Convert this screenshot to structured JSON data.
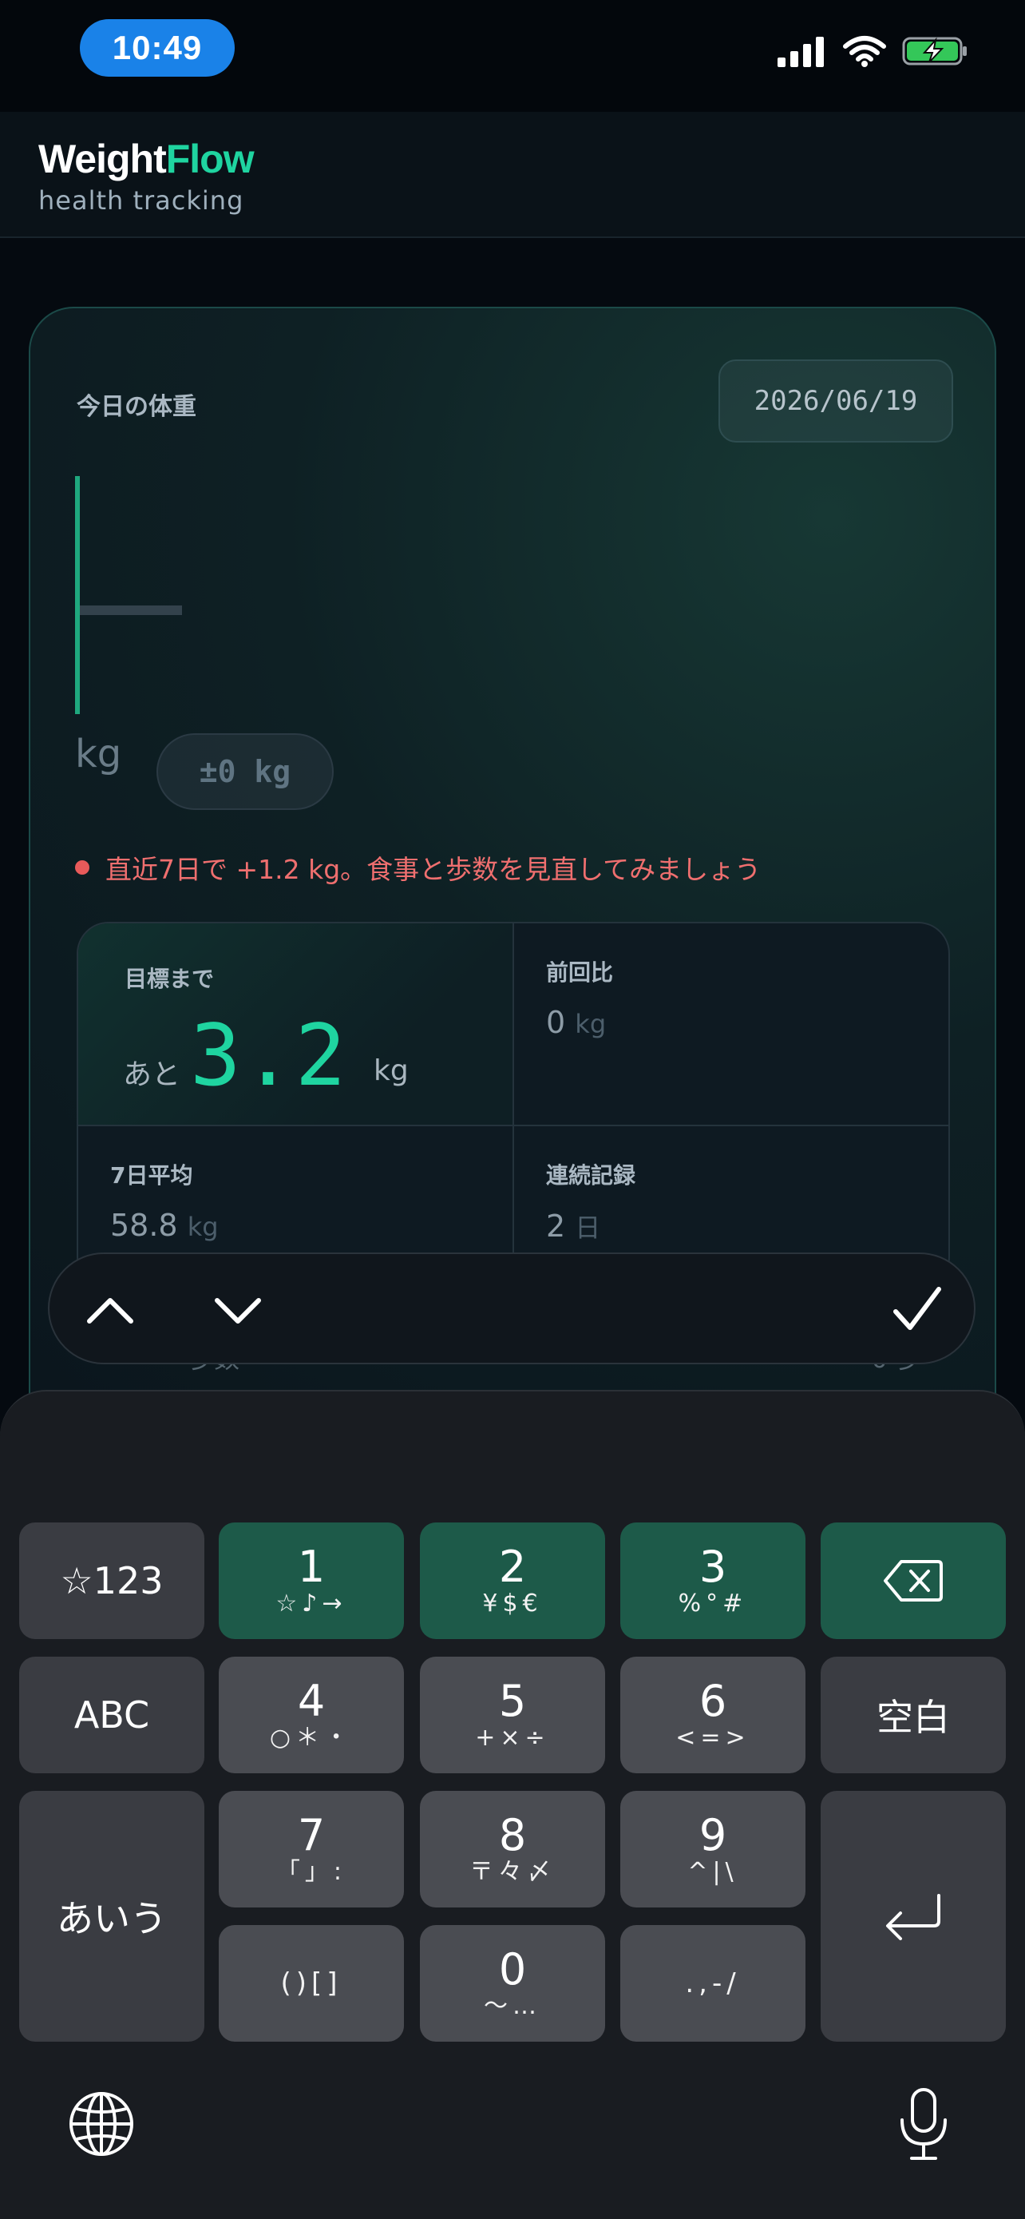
{
  "status_bar": {
    "time": "10:49"
  },
  "app": {
    "brand_main": "Weight",
    "brand_accent": "Flow",
    "subtitle": "health tracking"
  },
  "card": {
    "label": "今日の体重",
    "date": "2026/06/19",
    "unit": "kg",
    "delta": "±0 kg",
    "warning": "直近7日で +1.2 kg。食事と歩数を見直してみましょう"
  },
  "stats": {
    "goal_title": "目標まで",
    "goal_prefix": "あと",
    "goal_value": "3.2",
    "goal_unit": "kg",
    "prev_title": "前回比",
    "prev_value": "0",
    "prev_unit": "kg",
    "avg_title": "7日平均",
    "avg_value": "58.8",
    "avg_unit": "kg",
    "streak_title": "連続記録",
    "streak_value": "2",
    "streak_unit": "日"
  },
  "steps_row": {
    "label": "歩数",
    "value": "0 歩"
  },
  "keyboard": {
    "symbols_key": "☆123",
    "abc_key": "ABC",
    "kana_key": "あいう",
    "space_key": "空白",
    "keys": [
      {
        "num": "1",
        "sub": "☆♪→"
      },
      {
        "num": "2",
        "sub": "¥$€"
      },
      {
        "num": "3",
        "sub": "%°#"
      },
      {
        "num": "4",
        "sub": "○＊・"
      },
      {
        "num": "5",
        "sub": "+×÷"
      },
      {
        "num": "6",
        "sub": "<=>"
      },
      {
        "num": "7",
        "sub": "「」:"
      },
      {
        "num": "8",
        "sub": "〒々〆"
      },
      {
        "num": "9",
        "sub": "^|\\"
      },
      {
        "num": "",
        "sub": "()[]"
      },
      {
        "num": "0",
        "sub": "〜…"
      },
      {
        "num": "",
        "sub": ".,-/"
      }
    ]
  },
  "colors": {
    "accent": "#1fd4a0",
    "warning": "#ef6f6f",
    "time_pill": "#1a82e8"
  }
}
